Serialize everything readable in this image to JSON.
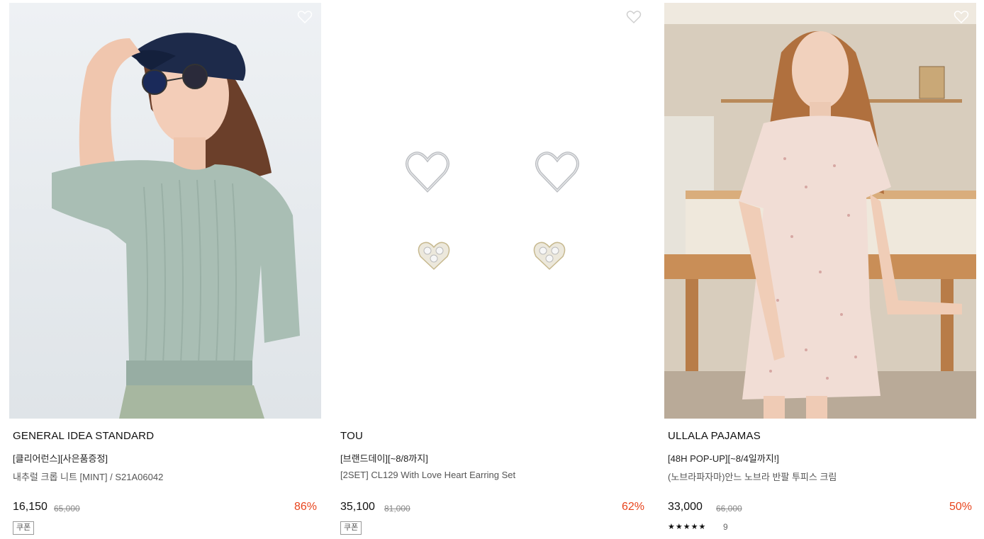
{
  "products": [
    {
      "brand": "GENERAL IDEA STANDARD",
      "promo": "[클리어런스][사은품증정]",
      "name": "내추럴 크롭 니트 [MINT] / S21A06042",
      "price": "16,150",
      "original_price": "65,000",
      "discount": "86%",
      "coupon": "쿠폰",
      "wishlist_icon": "heart-outline-icon"
    },
    {
      "brand": "TOU",
      "promo": "[브랜드데이][~8/8까지]",
      "name": "[2SET] CL129 With Love Heart Earring Set",
      "price": "35,100",
      "original_price": "81,000",
      "discount": "62%",
      "coupon": "쿠폰",
      "wishlist_icon": "heart-outline-icon"
    },
    {
      "brand": "ULLALA PAJAMAS",
      "promo": "[48H POP-UP][~8/4일까지!]",
      "name": "(노브라파자마)안느 노브라 반팔 투피스 크림",
      "price": "33,000",
      "original_price": "66,000",
      "discount": "50%",
      "rating": 4.5,
      "rating_stars": "★★★★★",
      "review_count": "9",
      "wishlist_icon": "heart-outline-icon"
    }
  ],
  "colors": {
    "discount": "#e8441c",
    "text": "#111111",
    "muted": "#888888"
  }
}
